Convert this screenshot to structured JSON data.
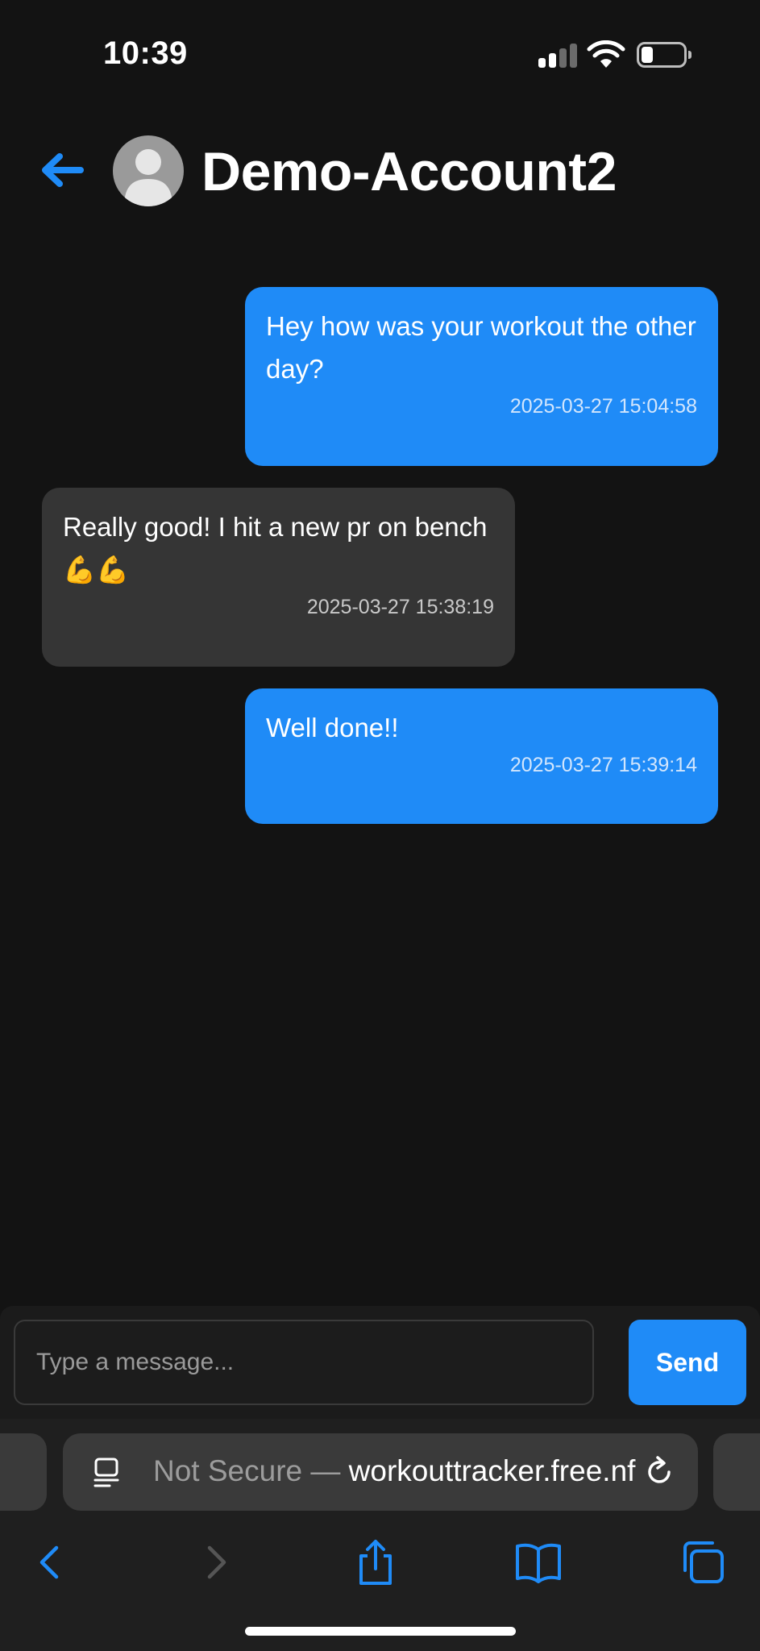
{
  "status_bar": {
    "time": "10:39"
  },
  "header": {
    "contact_name": "Demo-Account2"
  },
  "messages": [
    {
      "direction": "sent",
      "text": "Hey how was your workout the other day?",
      "timestamp": "2025-03-27 15:04:58"
    },
    {
      "direction": "received",
      "text": "Really good! I hit a new pr on bench 💪💪",
      "timestamp": "2025-03-27 15:38:19"
    },
    {
      "direction": "sent",
      "text": "Well done!!",
      "timestamp": "2025-03-27 15:39:14"
    }
  ],
  "composer": {
    "placeholder": "Type a message...",
    "send_label": "Send"
  },
  "browser": {
    "security_prefix": "Not Secure — ",
    "domain": "workouttracker.free.nf"
  },
  "colors": {
    "accent": "#1f8bf7",
    "background": "#131313",
    "received_bubble": "#353535"
  }
}
